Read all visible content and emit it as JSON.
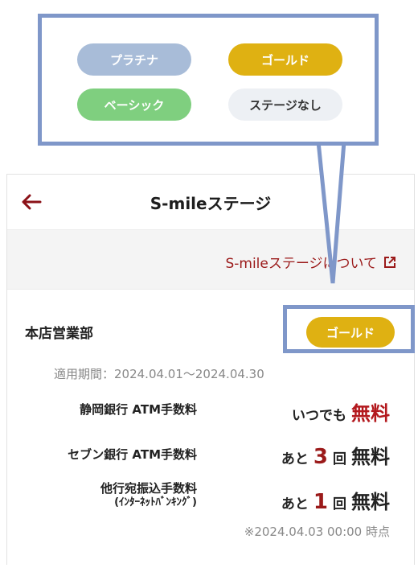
{
  "header": {
    "title": "S-mileステージ"
  },
  "about_link": {
    "label": "S-mileステージについて"
  },
  "branch_name": "本店営業部",
  "current_stage": {
    "label": "ゴールド",
    "color": "#dfb112"
  },
  "period": "適用期間：2024.04.01～2024.04.30",
  "fees": [
    {
      "label": "静岡銀行 ATM手数料",
      "sublabel": "",
      "prefix": "いつでも",
      "count": "",
      "unit": "",
      "status": "無料"
    },
    {
      "label": "セブン銀行 ATM手数料",
      "sublabel": "",
      "prefix": "あと",
      "count": "3",
      "unit": "回",
      "status": "無料"
    },
    {
      "label": "他行宛振込手数料",
      "sublabel": "(ｲﾝﾀｰﾈｯﾄﾊﾞﾝｷﾝｸﾞ)",
      "prefix": "あと",
      "count": "1",
      "unit": "回",
      "status": "無料"
    }
  ],
  "timestamp": "※2024.04.03 00:00 時点",
  "legend": [
    {
      "label": "プラチナ",
      "bg": "#a8bcd8",
      "fg": "#ffffff"
    },
    {
      "label": "ゴールド",
      "bg": "#dfb112",
      "fg": "#ffffff"
    },
    {
      "label": "ベーシック",
      "bg": "#7fcf7f",
      "fg": "#ffffff"
    },
    {
      "label": "ステージなし",
      "bg": "#edf0f4",
      "fg": "#333333"
    }
  ],
  "colors": {
    "accent": "#9b1a1a",
    "callout": "#7f97c9"
  }
}
